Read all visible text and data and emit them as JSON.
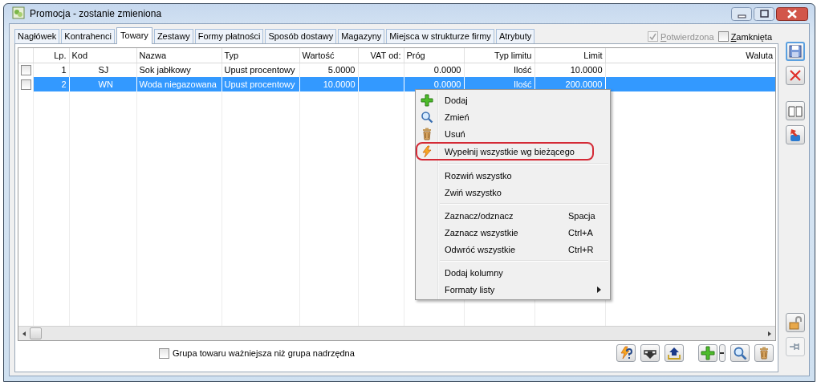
{
  "window": {
    "title": "Promocja - zostanie zmieniona"
  },
  "tabs": [
    {
      "label": "Nagłówek",
      "selected": false
    },
    {
      "label": "Kontrahenci",
      "selected": false
    },
    {
      "label": "Towary",
      "selected": true
    },
    {
      "label": "Zestawy",
      "selected": false
    },
    {
      "label": "Formy płatności",
      "selected": false
    },
    {
      "label": "Sposób dostawy",
      "selected": false
    },
    {
      "label": "Magazyny",
      "selected": false
    },
    {
      "label": "Miejsca w strukturze firmy",
      "selected": false
    },
    {
      "label": "Atrybuty",
      "selected": false
    }
  ],
  "status": [
    {
      "label": "Potwierdzona",
      "checked": true,
      "disabled": true
    },
    {
      "label": "Zamknięta",
      "checked": false,
      "disabled": false
    }
  ],
  "table": {
    "columns": [
      "Lp.",
      "Kod",
      "Nazwa",
      "Typ",
      "Wartość",
      "VAT od:",
      "Próg",
      "Typ limitu",
      "Limit",
      "Waluta"
    ],
    "rows": [
      {
        "checked": false,
        "selected": false,
        "lp": "1",
        "kod": "SJ",
        "nazwa": "Sok jabłkowy",
        "typ": "Upust procentowy",
        "wartosc": "5.0000",
        "prog": "0.0000",
        "typ_limitu": "Ilość",
        "limit": "10.0000"
      },
      {
        "checked": false,
        "selected": true,
        "lp": "2",
        "kod": "WN",
        "nazwa": "Woda niegazowana",
        "typ": "Upust procentowy",
        "wartosc": "10.0000",
        "prog": "0.0000",
        "typ_limitu": "Ilość",
        "limit": "200.0000"
      }
    ]
  },
  "context_menu": [
    {
      "kind": "item",
      "label": "Dodaj",
      "outlined": false
    },
    {
      "kind": "item",
      "label": "Zmień",
      "outlined": false
    },
    {
      "kind": "item",
      "label": "Usuń",
      "outlined": false
    },
    {
      "kind": "item",
      "label": "Wypełnij wszystkie wg bieżącego",
      "outlined": true
    },
    {
      "kind": "separator"
    },
    {
      "kind": "item",
      "label": "Rozwiń wszystko",
      "outlined": false
    },
    {
      "kind": "item",
      "label": "Zwiń wszystko",
      "outlined": false
    },
    {
      "kind": "separator"
    },
    {
      "kind": "item",
      "label": "Zaznacz/odznacz",
      "shortcut": "Spacja",
      "outlined": false
    },
    {
      "kind": "item",
      "label": "Zaznacz wszystkie",
      "shortcut": "Ctrl+A",
      "outlined": false
    },
    {
      "kind": "item",
      "label": "Odwróć wszystkie",
      "shortcut": "Ctrl+R",
      "outlined": false
    },
    {
      "kind": "separator"
    },
    {
      "kind": "item",
      "label": "Dodaj kolumny",
      "outlined": false
    },
    {
      "kind": "submenu",
      "label": "Formaty listy",
      "outlined": false
    }
  ],
  "footer_option": {
    "label": "Grupa towaru ważniejsza niż grupa nadrzędna",
    "checked": false
  }
}
